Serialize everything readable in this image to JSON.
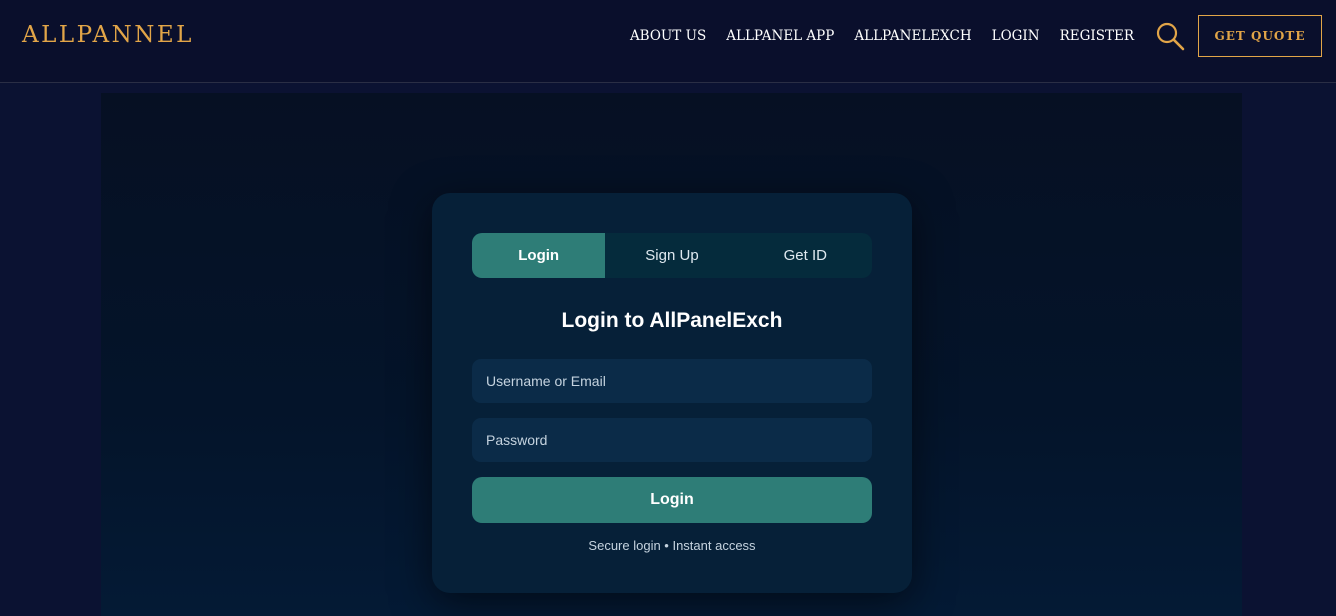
{
  "header": {
    "logo": "ALLPANNEL",
    "nav": [
      "ABOUT US",
      "ALLPANEL APP",
      "ALLPANELEXCH",
      "LOGIN",
      "REGISTER"
    ],
    "search_icon": "search-icon",
    "quote_label": "GET QUOTE"
  },
  "login_card": {
    "tabs": [
      "Login",
      "Sign Up",
      "Get ID"
    ],
    "active_tab": "Login",
    "title": "Login to AllPanelExch",
    "username_placeholder": "Username or Email",
    "username_value": "",
    "password_placeholder": "Password",
    "password_value": "",
    "submit_label": "Login",
    "note": "Secure login • Instant access"
  },
  "colors": {
    "accent_gold": "#e2a548",
    "teal": "#2e7d77",
    "header_bg": "#0a0f2c",
    "card_bg": "#062038",
    "input_bg": "#0b2b48"
  }
}
